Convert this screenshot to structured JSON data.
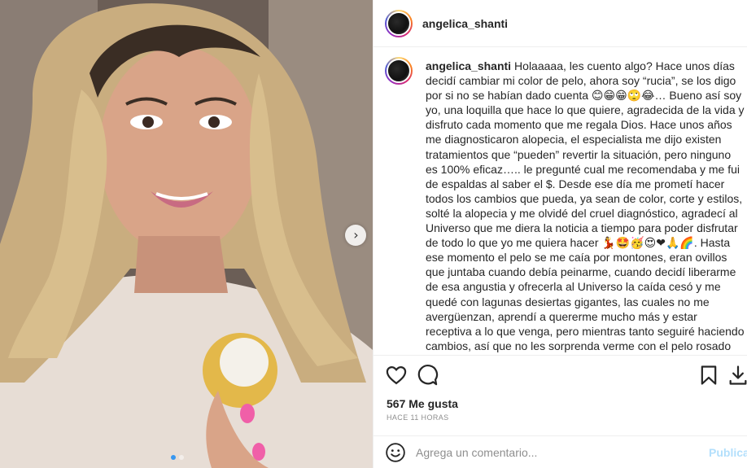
{
  "post": {
    "username": "angelica_shanti",
    "caption": "Holaaaaa, les cuento algo? Hace unos días decidí cambiar mi color de pelo, ahora soy “rucia”, se los digo por si no se habían dado cuenta 😊😁😁🙄😂… Bueno así soy yo, una loquilla que hace lo que quiere, agradecida de la vida y disfruto cada momento que me regala Dios. Hace unos años me diagnosticaron alopecia, el especialista me dijo existen tratamientos que “pueden” revertir la situación, pero ninguno es 100% eficaz….. le pregunté cual me recomendaba y me fui de espaldas al saber el $. Desde ese día me prometí hacer todos los cambios que pueda, ya sean de color, corte y estilos, solté la alopecia y me olvidé del cruel diagnóstico, agradecí al Universo que me diera la noticia a tiempo para poder disfrutar de todo lo que yo me quiera hacer 💃🤩🥳😍❤🙏🌈. Hasta ese momento el pelo se me caía por montones, eran ovillos que juntaba cuando debía peinarme, cuando decidí liberarme de esa angustia y ofrecerla al Universo la caída cesó y me quedé con lagunas desiertas gigantes, las cuales no me avergüenzan, aprendí a quererme mucho más y estar receptiva a lo que venga, pero mientras tanto seguiré haciendo cambios, así que no les sorprenda verme con el pelo rosado 📝🎯🌈. Lo escribo porque no me duele, es parte de mi historia, de mi vida y",
    "likes": "567 Me gusta",
    "time": "HACE 11 HORAS"
  },
  "comment": {
    "placeholder": "Agrega un comentario...",
    "publish_label": "Publicar"
  },
  "carousel": {
    "next_glyph": "›",
    "current_slide": 1,
    "total_slides": 2
  },
  "colors": {
    "publish_disabled": "#b2dffc",
    "secondary_text": "#8e8e8e",
    "border": "#efefef"
  },
  "icons": [
    "heart-icon",
    "comment-icon",
    "bookmark-icon",
    "download-icon",
    "emoji-icon",
    "chevron-right-icon"
  ]
}
